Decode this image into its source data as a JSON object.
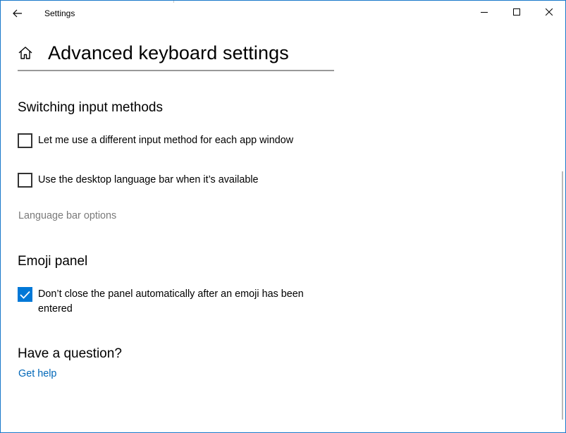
{
  "window": {
    "title": "Settings"
  },
  "header": {
    "page_title": "Advanced keyboard settings"
  },
  "switching": {
    "heading": "Switching input methods",
    "per_app_label": "Let me use a different input method for each app window",
    "per_app_checked": false,
    "language_bar_label": "Use the desktop language bar when it’s available",
    "language_bar_checked": false,
    "language_bar_options": "Language bar options"
  },
  "emoji": {
    "heading": "Emoji panel",
    "keep_open_label": "Don’t close the panel automatically after an emoji has been entered",
    "keep_open_checked": true
  },
  "help": {
    "heading": "Have a question?",
    "link": "Get help"
  },
  "colors": {
    "accent": "#0078d7",
    "link": "#0067b8",
    "disabled_text": "#7a7a7a",
    "window_border": "#1979ca"
  }
}
